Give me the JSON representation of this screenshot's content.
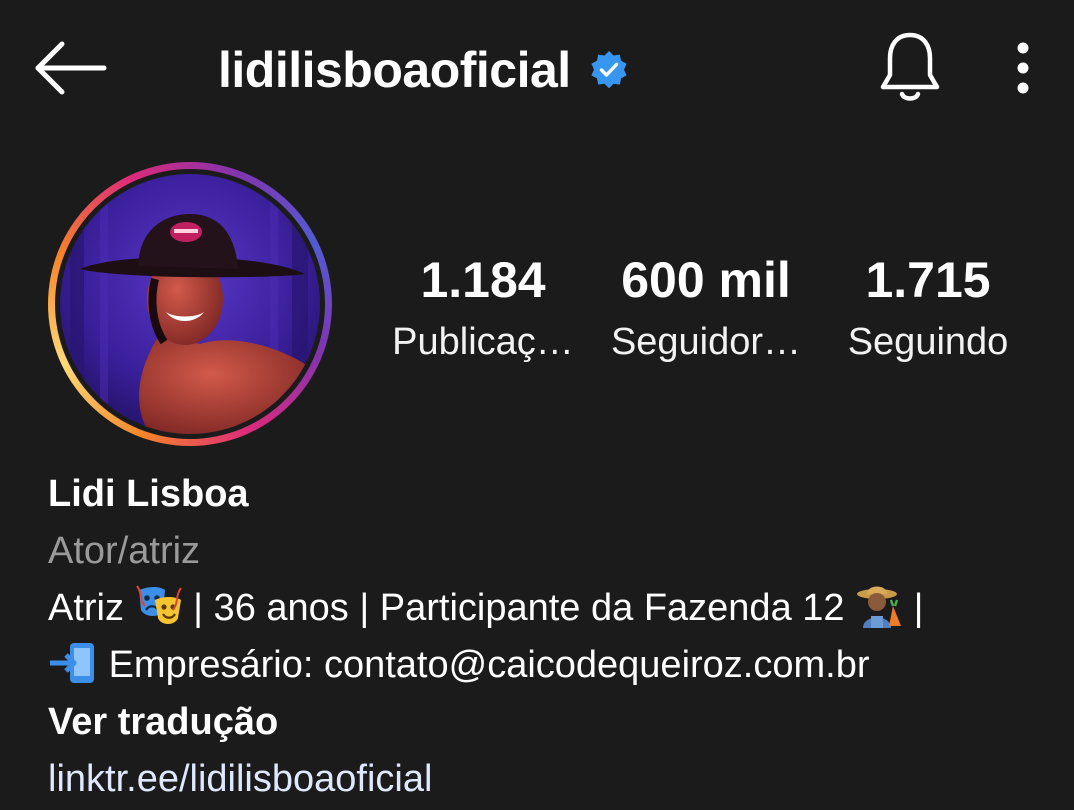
{
  "header": {
    "username": "lidilisboaoficial",
    "back_icon": "arrow-left-icon",
    "verified_icon": "verified-badge-icon",
    "bell_icon": "bell-icon",
    "more_icon": "more-vertical-icon",
    "verified_color": "#3797f0"
  },
  "stats": [
    {
      "value": "1.184",
      "label": "Publicaç…"
    },
    {
      "value": "600 mil",
      "label": "Seguidor…"
    },
    {
      "value": "1.715",
      "label": "Seguindo"
    }
  ],
  "bio": {
    "name": "Lidi Lisboa",
    "category": "Ator/atriz",
    "line1_a": "Atriz",
    "line1_b": "| 36 anos | Participante da Fazenda 12",
    "line1_c": "|",
    "line2": "Empresário: contato@caicodequeiroz.com.br",
    "translate": "Ver tradução",
    "link": "linktr.ee/lidilisboaoficial",
    "emoji_1": "performing-arts-emoji",
    "emoji_2": "farmer-emoji",
    "emoji_3": "phone-arrow-emoji"
  },
  "colors": {
    "background": "#1b1b1b",
    "category_gray": "#9a9a9a",
    "link": "#dfe8ff"
  }
}
